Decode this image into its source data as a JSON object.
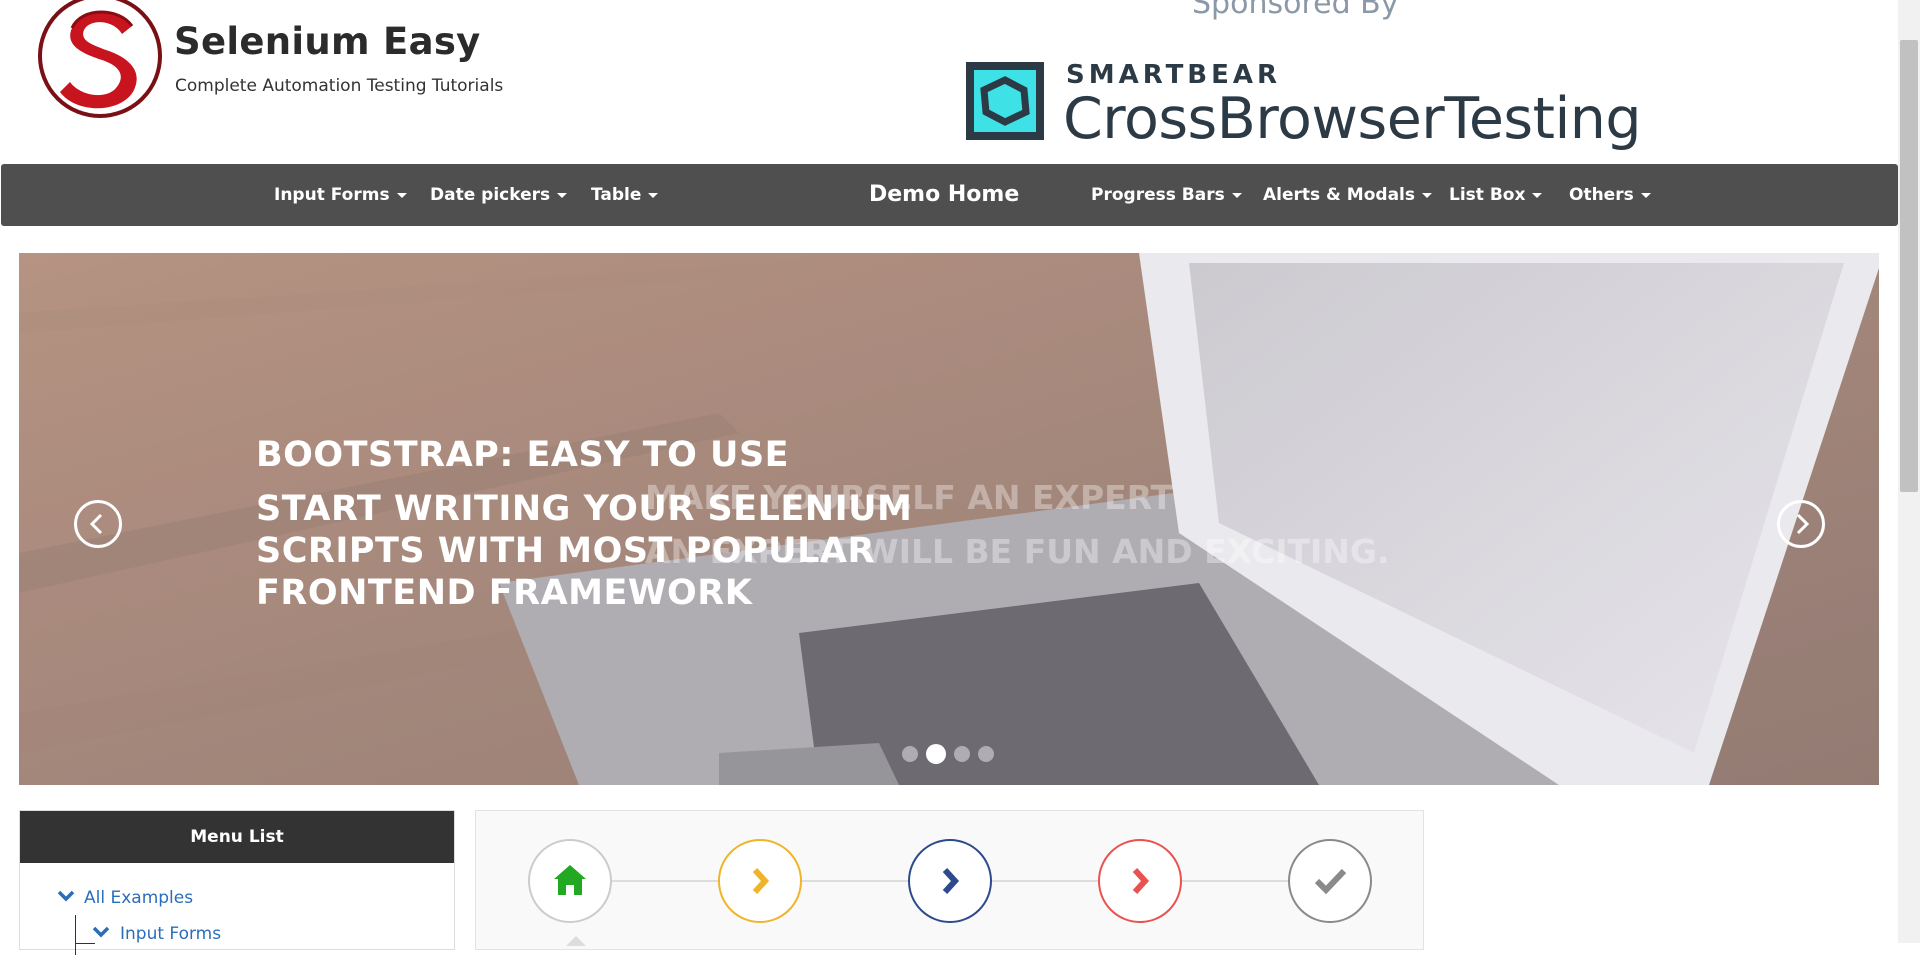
{
  "header": {
    "brand_title": "Selenium Easy",
    "brand_subtitle": "Complete Automation Testing Tutorials",
    "sponsor_label": "Sponsored By",
    "sponsor_company": "SMARTBEAR",
    "sponsor_product": "CrossBrowserTesting"
  },
  "nav": {
    "items_left": [
      {
        "label": "Input Forms",
        "icon": "caret-down-icon"
      },
      {
        "label": "Date pickers",
        "icon": "caret-down-icon"
      },
      {
        "label": "Table",
        "icon": "caret-down-icon"
      }
    ],
    "home": "Demo Home",
    "items_right": [
      {
        "label": "Progress Bars",
        "icon": "caret-down-icon"
      },
      {
        "label": "Alerts & Modals",
        "icon": "caret-down-icon"
      },
      {
        "label": "List Box",
        "icon": "caret-down-icon"
      },
      {
        "label": "Others",
        "icon": "caret-down-icon"
      }
    ]
  },
  "carousel": {
    "heading": "BOOTSTRAP: EASY TO USE",
    "text": "START WRITING YOUR SELENIUM SCRIPTS WITH MOST POPULAR FRONTEND FRAMEWORK",
    "ghost_heading": "MAKE YOURSELF AN EXPERT",
    "ghost_text": "AN EXPERT WILL BE FUN AND EXCITING.",
    "indicator_count": 4,
    "active_indicator": 2,
    "prev_icon": "chevron-left-circle-icon",
    "next_icon": "chevron-right-circle-icon"
  },
  "menu": {
    "title": "Menu List",
    "items": [
      {
        "label": "All Examples",
        "icon": "chevron-down-icon"
      },
      {
        "label": "Input Forms",
        "icon": "chevron-down-icon"
      }
    ]
  },
  "steps": {
    "items": [
      {
        "icon": "home-icon",
        "color": "#22a822"
      },
      {
        "icon": "chevron-right-icon",
        "color": "#f0b429"
      },
      {
        "icon": "chevron-right-icon",
        "color": "#2c4a8c"
      },
      {
        "icon": "chevron-right-icon",
        "color": "#e8534f"
      },
      {
        "icon": "check-icon",
        "color": "#8a8a8a"
      }
    ]
  },
  "colors": {
    "nav_bg": "#4f4f4f",
    "menu_header_bg": "#333333",
    "link": "#2a6ebb",
    "logo_red": "#c8141e",
    "sponsor_teal": "#3ee2e6"
  }
}
